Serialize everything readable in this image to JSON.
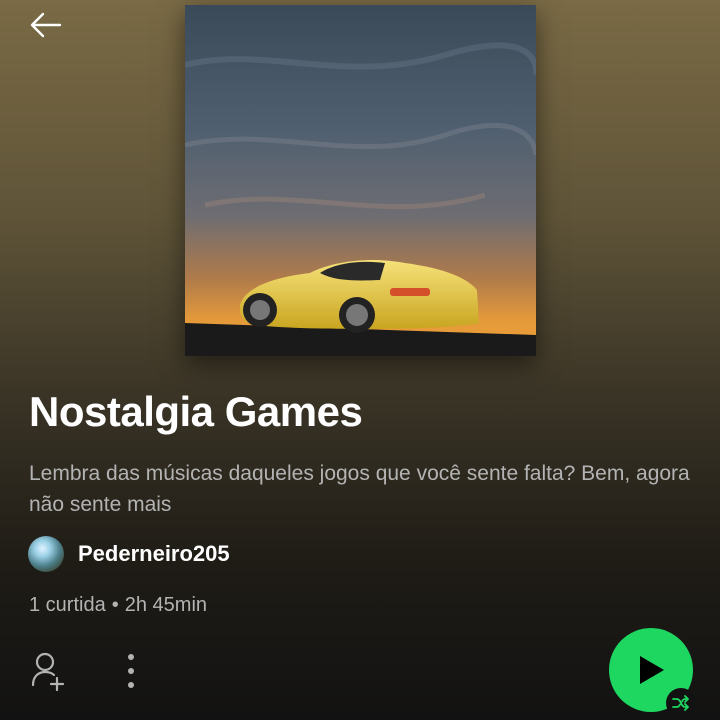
{
  "header": {
    "back_icon": "arrow-left-icon"
  },
  "playlist": {
    "cover_icon": "playlist-cover-image",
    "title": "Nostalgia Games",
    "description": "Lembra das músicas daqueles jogos que você sente falta? Bem, agora não sente mais",
    "owner": {
      "name": "Pederneiro205",
      "avatar_icon": "user-avatar"
    },
    "likes": "1 curtida",
    "separator": "•",
    "duration": "2h 45min"
  },
  "actions": {
    "follow_icon": "add-user-icon",
    "more_icon": "more-vertical-icon",
    "play_icon": "play-icon",
    "shuffle_icon": "shuffle-icon"
  },
  "colors": {
    "accent": "#1ed760",
    "background_top": "#7a6a45",
    "background_bottom": "#121212",
    "text_secondary": "#b3b3b3"
  }
}
